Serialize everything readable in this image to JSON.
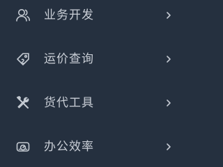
{
  "menu": {
    "items": [
      {
        "label": "业务开发",
        "icon": "user-icon"
      },
      {
        "label": "运价查询",
        "icon": "price-tag-icon"
      },
      {
        "label": "货代工具",
        "icon": "tools-icon"
      },
      {
        "label": "办公效率",
        "icon": "dashboard-icon"
      }
    ]
  },
  "colors": {
    "background": "#25303f",
    "text": "#c9ced6",
    "icon": "#c3c9d1"
  }
}
